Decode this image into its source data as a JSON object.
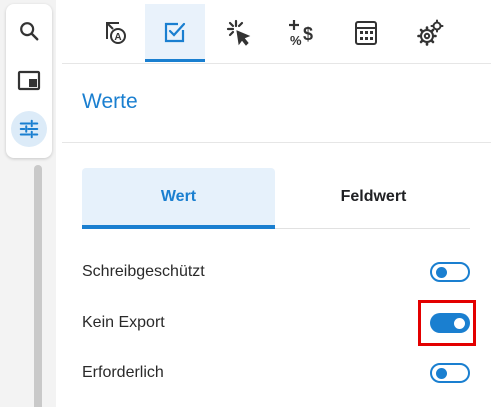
{
  "rail": {
    "items": [
      {
        "icon": "search-icon",
        "active": false
      },
      {
        "icon": "window-icon",
        "active": false
      },
      {
        "icon": "sliders-icon",
        "active": true
      }
    ]
  },
  "toolbar": {
    "tools": [
      {
        "icon": "form-field-icon",
        "active": false
      },
      {
        "icon": "checkbox-icon",
        "active": true
      },
      {
        "icon": "cursor-click-icon",
        "active": false
      },
      {
        "icon": "calc-symbols-icon",
        "active": false
      },
      {
        "icon": "calculator-icon",
        "active": false
      },
      {
        "icon": "gears-icon",
        "active": false
      }
    ]
  },
  "section": {
    "title": "Werte"
  },
  "tabs": [
    {
      "label": "Wert",
      "selected": true
    },
    {
      "label": "Feldwert",
      "selected": false
    }
  ],
  "options": [
    {
      "label": "Schreibgeschützt",
      "checked": false
    },
    {
      "label": "Kein Export",
      "checked": true,
      "highlighted": true
    },
    {
      "label": "Erforderlich",
      "checked": false
    }
  ],
  "colors": {
    "accent": "#1a7fd0",
    "highlight": "#e30000"
  }
}
